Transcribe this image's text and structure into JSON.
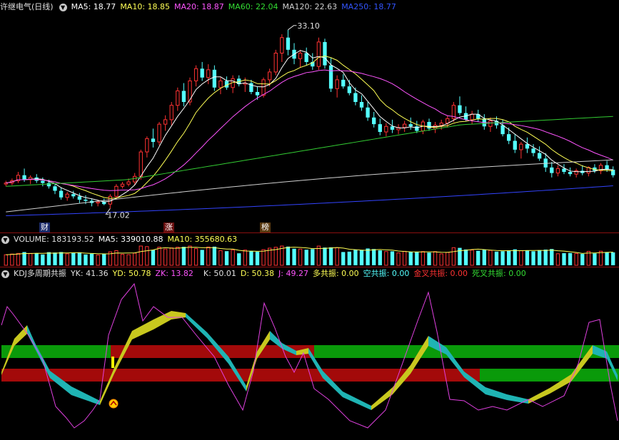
{
  "colors": {
    "up": "#ff3232",
    "down": "#54ffff",
    "ma5": "#ffffff",
    "ma10": "#ffff55",
    "ma20": "#ff55ff",
    "ma60": "#33cc33",
    "ma120": "#d0d0d0",
    "ma250": "#3344ff",
    "yellow": "#c8c81e",
    "cyan": "#1fb4b4",
    "green": "#0a9a0a",
    "red": "#a30a0a",
    "magenta": "#e040e0"
  },
  "price_header": {
    "stock": "许继电气(日线)",
    "ma5": "MA5: 18.77",
    "ma10": "MA10: 18.85",
    "ma20": "MA20: 18.87",
    "ma60": "MA60: 22.04",
    "ma120": "MA120: 22.63",
    "ma250": "MA250: 18.77"
  },
  "price_annotations": {
    "high": "33.10",
    "low": "17.02"
  },
  "badges": [
    "财",
    "涨",
    "榜"
  ],
  "volume_header": {
    "vol": "VOLUME: 183193.52",
    "ma5": "MA5: 339010.88",
    "ma10": "MA10: 355680.63"
  },
  "kdj_header": {
    "name": "KDJ多周期共振",
    "yk": "YK: 41.36",
    "yd": "YD: 50.78",
    "zk": "ZK: 13.82",
    "k": "K: 50.01",
    "d": "D: 50.38",
    "j": "J: 49.27",
    "duo": "多共振: 0.00",
    "kong": "空共振: 0.00",
    "jin": "金叉共振: 0.00",
    "si": "死叉共振: 0.00"
  },
  "chart_data": [
    {
      "type": "candlestick",
      "ylim": [
        16.0,
        34.5
      ],
      "candles": [
        [
          19.2,
          19.5,
          19.0,
          19.3
        ],
        [
          19.3,
          19.7,
          19.1,
          19.5
        ],
        [
          19.5,
          20.3,
          19.3,
          20.0
        ],
        [
          20.0,
          20.6,
          19.4,
          19.6
        ],
        [
          19.6,
          20.0,
          19.2,
          19.8
        ],
        [
          19.8,
          20.1,
          19.3,
          19.5
        ],
        [
          19.5,
          19.8,
          19.0,
          19.3
        ],
        [
          19.3,
          19.6,
          18.8,
          19.0
        ],
        [
          19.0,
          19.2,
          18.3,
          18.6
        ],
        [
          18.6,
          18.9,
          17.8,
          18.0
        ],
        [
          18.0,
          18.5,
          17.7,
          18.3
        ],
        [
          18.3,
          18.6,
          17.9,
          18.1
        ],
        [
          18.1,
          18.4,
          17.5,
          17.8
        ],
        [
          17.8,
          18.2,
          17.4,
          17.7
        ],
        [
          17.7,
          17.9,
          17.2,
          17.5
        ],
        [
          17.5,
          17.8,
          17.2,
          17.6
        ],
        [
          17.6,
          17.9,
          17.3,
          17.4
        ],
        [
          17.4,
          18.3,
          17.0,
          18.1
        ],
        [
          18.1,
          19.2,
          17.9,
          19.0
        ],
        [
          19.0,
          19.4,
          18.8,
          19.2
        ],
        [
          19.2,
          19.7,
          19.0,
          19.4
        ],
        [
          19.4,
          20.2,
          19.1,
          19.9
        ],
        [
          19.9,
          22.3,
          19.6,
          22.1
        ],
        [
          22.1,
          23.5,
          21.6,
          23.3
        ],
        [
          23.3,
          24.2,
          22.5,
          23.0
        ],
        [
          23.0,
          24.8,
          22.7,
          24.6
        ],
        [
          24.6,
          25.4,
          24.0,
          25.0
        ],
        [
          25.0,
          26.6,
          24.5,
          26.3
        ],
        [
          26.3,
          27.9,
          25.8,
          27.6
        ],
        [
          27.6,
          28.3,
          26.2,
          26.6
        ],
        [
          26.6,
          28.8,
          26.3,
          28.5
        ],
        [
          28.5,
          29.9,
          28.0,
          29.6
        ],
        [
          29.6,
          30.2,
          28.5,
          28.8
        ],
        [
          28.8,
          30.0,
          28.2,
          29.5
        ],
        [
          29.5,
          29.9,
          27.6,
          27.9
        ],
        [
          27.9,
          28.8,
          27.3,
          28.5
        ],
        [
          28.5,
          28.9,
          27.7,
          27.9
        ],
        [
          27.9,
          29.0,
          27.4,
          28.7
        ],
        [
          28.7,
          29.0,
          28.0,
          28.2
        ],
        [
          28.2,
          28.8,
          27.5,
          28.3
        ],
        [
          28.3,
          28.6,
          27.3,
          27.5
        ],
        [
          27.5,
          28.0,
          26.8,
          27.2
        ],
        [
          27.2,
          28.8,
          27.0,
          28.6
        ],
        [
          28.6,
          29.6,
          28.0,
          29.3
        ],
        [
          29.3,
          31.3,
          29.0,
          31.0
        ],
        [
          31.0,
          32.7,
          30.2,
          32.4
        ],
        [
          32.4,
          33.1,
          30.8,
          31.3
        ],
        [
          31.3,
          31.9,
          30.0,
          30.5
        ],
        [
          30.5,
          31.3,
          29.7,
          31.0
        ],
        [
          31.0,
          31.5,
          29.9,
          30.2
        ],
        [
          30.2,
          31.0,
          29.5,
          29.8
        ],
        [
          29.8,
          32.4,
          29.5,
          32.0
        ],
        [
          32.0,
          32.3,
          29.6,
          29.9
        ],
        [
          29.9,
          30.6,
          27.5,
          27.8
        ],
        [
          27.8,
          29.0,
          27.0,
          28.6
        ],
        [
          28.6,
          29.1,
          27.8,
          28.0
        ],
        [
          28.0,
          28.6,
          27.2,
          27.4
        ],
        [
          27.4,
          27.9,
          26.3,
          26.6
        ],
        [
          26.6,
          27.2,
          25.8,
          26.1
        ],
        [
          26.1,
          26.6,
          24.9,
          25.2
        ],
        [
          25.2,
          25.7,
          24.3,
          24.6
        ],
        [
          24.6,
          25.1,
          23.6,
          23.9
        ],
        [
          23.9,
          24.7,
          23.5,
          24.4
        ],
        [
          24.4,
          25.0,
          23.8,
          24.1
        ],
        [
          24.1,
          24.6,
          23.7,
          24.3
        ],
        [
          24.3,
          24.9,
          23.9,
          24.6
        ],
        [
          24.6,
          25.2,
          24.1,
          24.4
        ],
        [
          24.4,
          24.9,
          23.8,
          24.0
        ],
        [
          24.0,
          25.0,
          23.7,
          24.8
        ],
        [
          24.8,
          25.1,
          24.0,
          24.2
        ],
        [
          24.2,
          24.8,
          23.8,
          24.5
        ],
        [
          24.5,
          25.0,
          24.1,
          24.7
        ],
        [
          24.7,
          25.4,
          24.3,
          25.1
        ],
        [
          25.1,
          26.6,
          24.8,
          26.3
        ],
        [
          26.3,
          27.1,
          25.4,
          25.6
        ],
        [
          25.6,
          26.2,
          24.9,
          25.0
        ],
        [
          25.0,
          25.8,
          24.6,
          25.5
        ],
        [
          25.5,
          25.9,
          24.8,
          25.1
        ],
        [
          25.1,
          25.5,
          24.1,
          24.4
        ],
        [
          24.4,
          25.2,
          23.9,
          24.9
        ],
        [
          24.9,
          25.3,
          24.2,
          24.5
        ],
        [
          24.5,
          25.0,
          23.5,
          23.7
        ],
        [
          23.7,
          24.3,
          22.8,
          23.1
        ],
        [
          23.1,
          23.7,
          22.0,
          22.3
        ],
        [
          22.3,
          23.0,
          21.5,
          22.8
        ],
        [
          22.8,
          23.4,
          22.0,
          22.4
        ],
        [
          22.4,
          22.8,
          21.7,
          22.0
        ],
        [
          22.0,
          22.6,
          21.3,
          21.5
        ],
        [
          21.5,
          22.0,
          20.3,
          20.7
        ],
        [
          20.7,
          21.2,
          19.8,
          20.2
        ],
        [
          20.2,
          20.9,
          19.9,
          20.6
        ],
        [
          20.6,
          21.0,
          20.1,
          20.3
        ],
        [
          20.3,
          20.7,
          19.9,
          20.1
        ],
        [
          20.1,
          20.6,
          19.8,
          20.4
        ],
        [
          20.4,
          20.9,
          20.0,
          20.2
        ],
        [
          20.2,
          20.8,
          19.9,
          20.7
        ],
        [
          20.7,
          21.0,
          20.2,
          20.4
        ],
        [
          20.4,
          21.1,
          20.1,
          20.9
        ],
        [
          20.9,
          21.3,
          20.3,
          20.5
        ],
        [
          20.5,
          20.8,
          19.8,
          20.0
        ]
      ]
    },
    {
      "type": "bar",
      "name": "VOLUME",
      "note": "volume bars, no axis labels shown"
    },
    {
      "type": "indicator",
      "name": "KDJ多周期共振"
    }
  ]
}
